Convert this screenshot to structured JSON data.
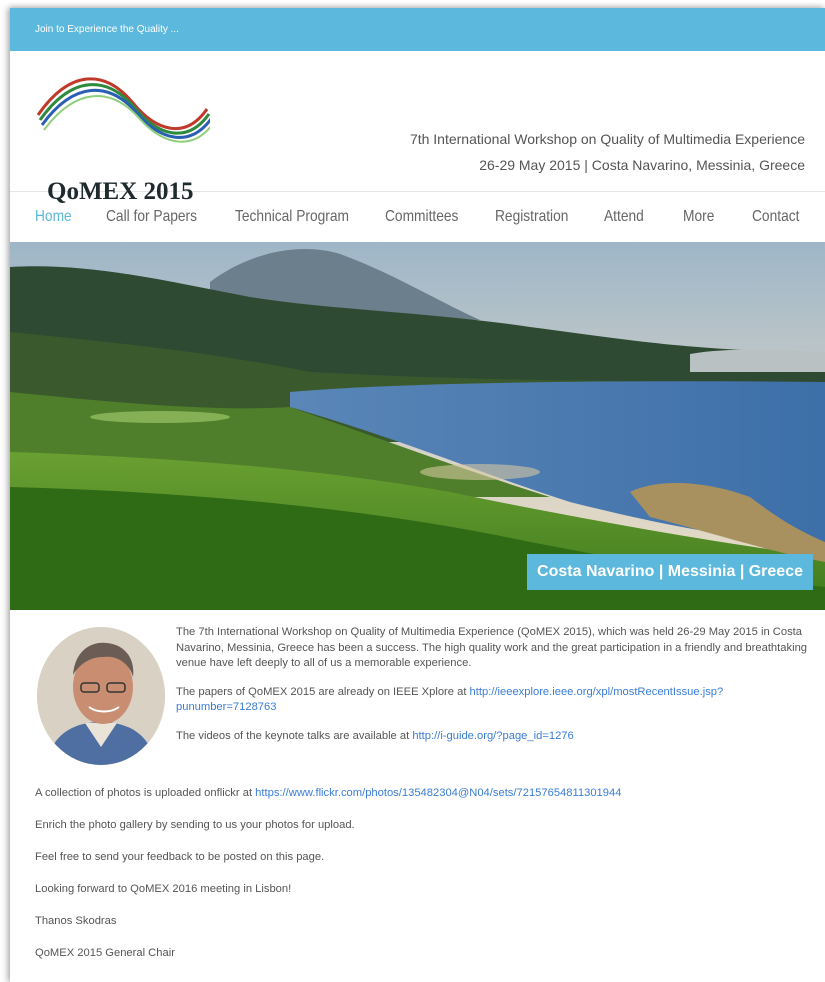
{
  "topbar": {
    "tagline": "Join to Experience the Quality ..."
  },
  "header": {
    "logo_text": "QoMEX 2015",
    "line1": "7th International Workshop on Quality of Multimedia Experience",
    "line2": "26-29 May 2015 | Costa Navarino, Messinia, Greece"
  },
  "nav": {
    "items": [
      "Home",
      "Call for Papers",
      "Technical Program",
      "Committees",
      "Registration",
      "Attend",
      "More",
      "Contact"
    ],
    "active": "Home"
  },
  "hero": {
    "caption": "Costa Navarino | Messinia | Greece"
  },
  "content": {
    "intro_p1": "The 7th International Workshop on Quality of Multimedia Experience (QoMEX 2015), which was held 26-29 May 2015 in Costa Navarino, Messinia, Greece has been a success. The high quality work and the great participation in a friendly and breathtaking venue have left deeply to all of us a memorable experience.",
    "papers_text": "The papers of QoMEX 2015 are already on IEEE Xplore at ",
    "papers_link": "http://ieeexplore.ieee.org/xpl/mostRecentIssue.jsp?punumber=7128763",
    "videos_text": "The videos of the keynote talks are available at ",
    "videos_link": "http://i-guide.org/?page_id=1276",
    "photos_text": "A collection of photos is uploaded onflickr at ",
    "photos_link": "https://www.flickr.com/photos/135482304@N04/sets/72157654811301944",
    "enrich": "Enrich the photo gallery by sending to us your photos for upload.",
    "feedback": "Feel free to send your feedback to be posted on this page.",
    "forward": "Looking forward to QoMEX 2016 meeting in Lisbon!",
    "name": "Thanos Skodras",
    "role": "QoMEX 2015 General Chair"
  },
  "colors": {
    "accent": "#5cb8dd",
    "link": "#3a7dd6"
  }
}
